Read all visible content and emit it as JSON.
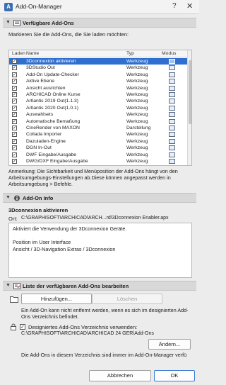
{
  "window": {
    "title": "Add-On-Manager",
    "help": "?",
    "close": "✕"
  },
  "available": {
    "header": "Verfügbare Add-Ons",
    "instruction": "Markieren Sie die Add-Ons, die Sie laden möchten:",
    "columns": {
      "load": "Laden",
      "name": "Name",
      "type": "Typ",
      "mode": "Modus"
    },
    "rows": [
      {
        "name": "3Dconnexion aktivieren",
        "type": "Werkzeug",
        "checked": true,
        "selected": true
      },
      {
        "name": "3DStudio Out",
        "type": "Werkzeug",
        "checked": true
      },
      {
        "name": "Add-On Update-Checker",
        "type": "Werkzeug",
        "checked": true
      },
      {
        "name": "Aktive Ebene",
        "type": "Werkzeug",
        "checked": true
      },
      {
        "name": "Ansicht ausrichten",
        "type": "Werkzeug",
        "checked": true
      },
      {
        "name": "ARCHICAD Online Kurse",
        "type": "Werkzeug",
        "checked": true
      },
      {
        "name": "Artlantis 2019 Out(1.1.3)",
        "type": "Werkzeug",
        "checked": true
      },
      {
        "name": "Artlantis 2020 Out(1.0.1)",
        "type": "Werkzeug",
        "checked": true
      },
      {
        "name": "Auswahlsets",
        "type": "Werkzeug",
        "checked": true
      },
      {
        "name": "Automatische Bemaßung",
        "type": "Werkzeug",
        "checked": true
      },
      {
        "name": "CineRender von MAXON",
        "type": "Darstellung",
        "checked": true
      },
      {
        "name": "Collada Importer",
        "type": "Werkzeug",
        "checked": true
      },
      {
        "name": "Dazuladen-Engine",
        "type": "Werkzeug",
        "checked": true
      },
      {
        "name": "DGN In-Out",
        "type": "Werkzeug",
        "checked": true
      },
      {
        "name": "DWF Eingabe/Ausgabe",
        "type": "Werkzeug",
        "checked": true
      },
      {
        "name": "DWG/DXF Eingabe/Ausgabe",
        "type": "Werkzeug",
        "checked": true
      }
    ],
    "note": "Anmerkung: Die Sichtbarkeit und Menüposition der Add-Ons hängt von den Arbeitsumgebungs-Einstellungen ab.Diese können angepasst werden in Arbeitsumgebung > Befehle."
  },
  "info": {
    "header": "Add-On Info",
    "name": "3Dconnexion aktivieren",
    "location_label": "Ort:",
    "location_path": "C:\\GRAPHISOFT\\ARCHICAD\\ARCH...rd\\3Dconnexion Enabler.apx",
    "description_lines": [
      "Aktiviert die Verwendung der  3Dconnexion Geräte.",
      "",
      "Position im User Interface",
      "Ansicht / 3D-Navigation Extras / 3Dconnexion"
    ]
  },
  "edit": {
    "header": "Liste der verfügbaren Add-Ons bearbeiten",
    "add_button": "Hinzufügen...",
    "delete_button": "Löschen",
    "warning": "Ein Add-On kann nicht entfernt werden, wenn es sich im designierten Add-Ons Verzeichnis befindet.",
    "use_folder_label": "Designiertes Add-Ons Verzeichnis verwenden:",
    "folder_path": "C:\\GRAPHISOFT\\ARCHICAD\\ARCHICAD 24 GER\\Add-Ons",
    "change_button": "Ändern...",
    "footer_note": "Die Add-Ons in diesem Verzeichnis sind immer im Add-On-Manager verfü"
  },
  "buttons": {
    "cancel": "Abbrechen",
    "ok": "OK"
  },
  "colors": {
    "selection": "#2f6fd0",
    "accent": "#3b78d4"
  }
}
